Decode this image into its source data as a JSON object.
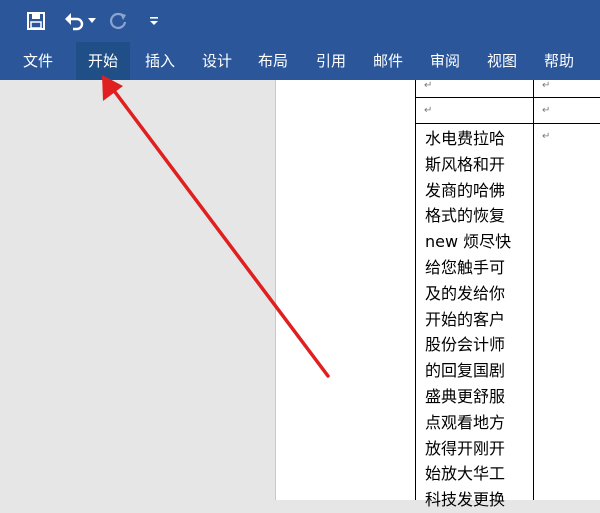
{
  "quick_access": {
    "save_icon": "save-icon",
    "undo_icon": "undo-icon",
    "undo_dropdown_icon": "caret-down-icon",
    "redo_icon": "redo-icon",
    "customize_icon": "customize-toolbar-icon"
  },
  "ribbon": {
    "tabs": [
      {
        "label": "文件"
      },
      {
        "label": "开始"
      },
      {
        "label": "插入"
      },
      {
        "label": "设计"
      },
      {
        "label": "布局"
      },
      {
        "label": "引用"
      },
      {
        "label": "邮件"
      },
      {
        "label": "审阅"
      },
      {
        "label": "视图"
      },
      {
        "label": "帮助"
      }
    ],
    "active_tab": "开始"
  },
  "document": {
    "paragraph_mark": "↵",
    "cell_lines": [
      "水电费拉哈",
      "斯风格和开",
      "发商的哈佛",
      "格式的恢复",
      "new 烦尽快",
      "给您触手可",
      "及的发给你",
      "开始的客户",
      "股份会计师",
      "的回复国剧",
      "盛典更舒服",
      "点观看地方",
      "放得开刚开",
      "始放大华工",
      "科技发更换"
    ]
  },
  "colors": {
    "ribbon_blue": "#2b579a",
    "active_tab": "#1f4f86",
    "annotation_arrow": "#e02020"
  }
}
